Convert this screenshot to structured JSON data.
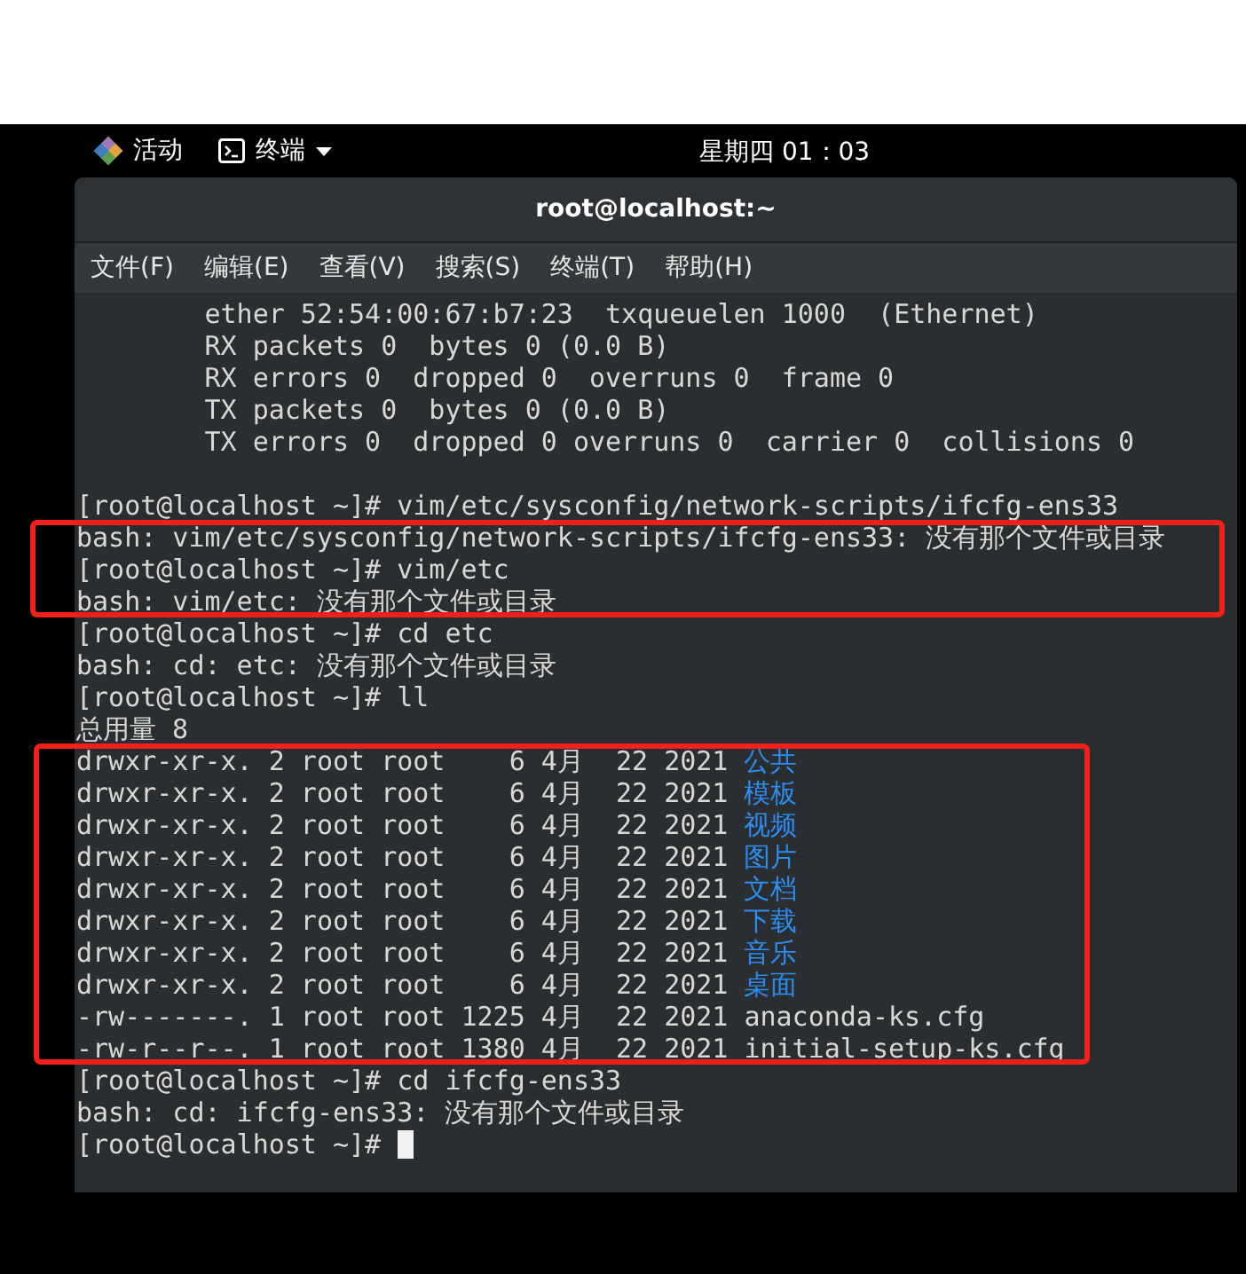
{
  "top_bar": {
    "activities": "活动",
    "app_menu": "终端",
    "clock": "星期四 01：03"
  },
  "window": {
    "title": "root@localhost:~"
  },
  "menu": [
    "文件(F)",
    "编辑(E)",
    "查看(V)",
    "搜索(S)",
    "终端(T)",
    "帮助(H)"
  ],
  "terminal": {
    "blocks": [
      {
        "highlighted": false,
        "lines": [
          {
            "kind": "text",
            "text": "        ether 52:54:00:67:b7:23  txqueuelen 1000  (Ethernet)"
          },
          {
            "kind": "text",
            "text": "        RX packets 0  bytes 0 (0.0 B)"
          },
          {
            "kind": "text",
            "text": "        RX errors 0  dropped 0  overruns 0  frame 0"
          },
          {
            "kind": "text",
            "text": "        TX packets 0  bytes 0 (0.0 B)"
          },
          {
            "kind": "text",
            "text": "        TX errors 0  dropped 0 overruns 0  carrier 0  collisions 0"
          },
          {
            "kind": "blank"
          },
          {
            "kind": "text",
            "text": "[root@localhost ~]# vim/etc/sysconfig/network-scripts/ifcfg-ens33"
          }
        ]
      },
      {
        "highlighted": true,
        "lines": [
          {
            "kind": "text",
            "text": "bash: vim/etc/sysconfig/network-scripts/ifcfg-ens33: 没有那个文件或目录"
          },
          {
            "kind": "text",
            "text": "[root@localhost ~]# vim/etc"
          },
          {
            "kind": "text",
            "text": "bash: vim/etc: 没有那个文件或目录"
          }
        ]
      },
      {
        "highlighted": false,
        "lines": [
          {
            "kind": "text",
            "text": "[root@localhost ~]# cd etc"
          },
          {
            "kind": "text",
            "text": "bash: cd: etc: 没有那个文件或目录"
          },
          {
            "kind": "text",
            "text": "[root@localhost ~]# ll"
          },
          {
            "kind": "text",
            "text": "总用量 8"
          }
        ]
      },
      {
        "highlighted": true,
        "lines": [
          {
            "kind": "listing",
            "meta": "drwxr-xr-x. 2 root root    6 4月  22 2021",
            "name": "公共",
            "directory": true
          },
          {
            "kind": "listing",
            "meta": "drwxr-xr-x. 2 root root    6 4月  22 2021",
            "name": "模板",
            "directory": true
          },
          {
            "kind": "listing",
            "meta": "drwxr-xr-x. 2 root root    6 4月  22 2021",
            "name": "视频",
            "directory": true
          },
          {
            "kind": "listing",
            "meta": "drwxr-xr-x. 2 root root    6 4月  22 2021",
            "name": "图片",
            "directory": true
          },
          {
            "kind": "listing",
            "meta": "drwxr-xr-x. 2 root root    6 4月  22 2021",
            "name": "文档",
            "directory": true
          },
          {
            "kind": "listing",
            "meta": "drwxr-xr-x. 2 root root    6 4月  22 2021",
            "name": "下载",
            "directory": true
          },
          {
            "kind": "listing",
            "meta": "drwxr-xr-x. 2 root root    6 4月  22 2021",
            "name": "音乐",
            "directory": true
          },
          {
            "kind": "listing",
            "meta": "drwxr-xr-x. 2 root root    6 4月  22 2021",
            "name": "桌面",
            "directory": true
          },
          {
            "kind": "listing",
            "meta": "-rw-------. 1 root root 1225 4月  22 2021",
            "name": "anaconda-ks.cfg",
            "directory": false
          },
          {
            "kind": "listing",
            "meta": "-rw-r--r--. 1 root root 1380 4月  22 2021",
            "name": "initial-setup-ks.cfg",
            "directory": false
          }
        ]
      },
      {
        "highlighted": false,
        "lines": [
          {
            "kind": "text",
            "text": "[root@localhost ~]# cd ifcfg-ens33"
          },
          {
            "kind": "text",
            "text": "bash: cd: ifcfg-ens33: 没有那个文件或目录"
          },
          {
            "kind": "prompt",
            "text": "[root@localhost ~]# ",
            "cursor": true
          }
        ]
      }
    ]
  }
}
